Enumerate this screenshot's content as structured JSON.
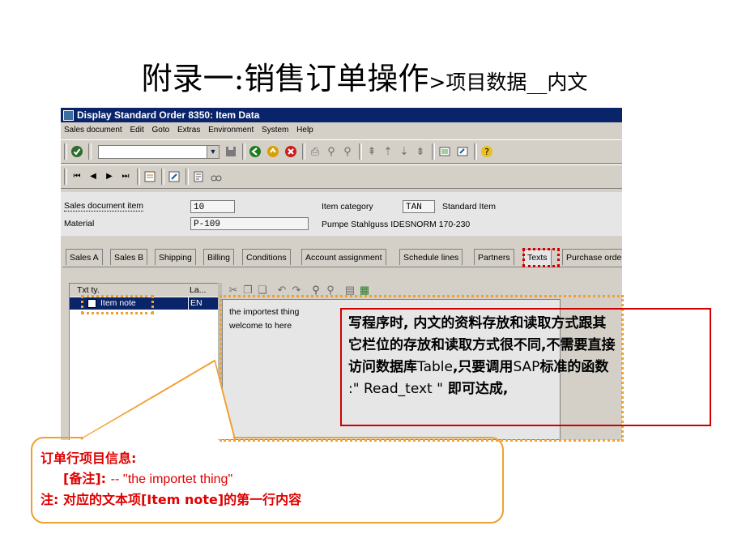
{
  "slide": {
    "title_main": "附录一:销售订单操作",
    "title_sub": ">项目数据__内文"
  },
  "window": {
    "title": "Display Standard Order 8350: Item Data",
    "menu": [
      "Sales document",
      "Edit",
      "Goto",
      "Extras",
      "Environment",
      "System",
      "Help"
    ]
  },
  "header_fields": {
    "sales_doc_item_label": "Sales document item",
    "sales_doc_item_value": "10",
    "item_category_label": "Item category",
    "item_category_value": "TAN",
    "item_category_desc": "Standard Item",
    "material_label": "Material",
    "material_value": "P-109",
    "material_desc": "Pumpe Stahlguss IDESNORM 170-230"
  },
  "tabs": [
    "Sales A",
    "Sales B",
    "Shipping",
    "Billing",
    "Conditions",
    "Account assignment",
    "Schedule lines",
    "Partners",
    "Texts",
    "Purchase orde"
  ],
  "text_list": {
    "col_type": "Txt ty.",
    "col_lang": "La...",
    "row_type": "Item note",
    "row_lang": "EN"
  },
  "editor": {
    "line1": "the importest thing",
    "line2": "welcome to here"
  },
  "note": {
    "line1": "写程序时, 内文的资料存放和读取方式跟其",
    "line2": "它栏位的存放和读取方式很不同,不需要直接",
    "line3_a": "访问数据库",
    "line3_b": "Table",
    "line3_c": ",只要调用",
    "line3_d": "SAP",
    "line3_e": "标准的函数",
    "line4_a": ":\" Read_text \"",
    "line4_b": " 即可达成,"
  },
  "callout": {
    "line1": "订单行项目信息:",
    "line2_a": "[备注]: ",
    "line2_b": " -- ''the importet thing\"",
    "line3": "注: 对应的文本项[Item note]的第一行内容"
  },
  "colors": {
    "title_bar": "#0a246a",
    "highlight_red": "#e00000",
    "callout_orange": "#f0a030",
    "dotted_orange": "#f0a030",
    "dotted_red": "#d00000"
  }
}
